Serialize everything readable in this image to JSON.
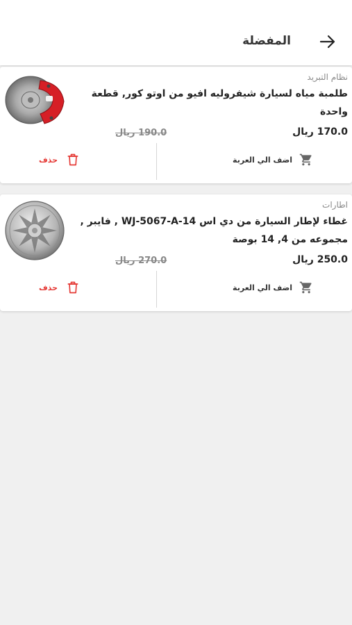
{
  "header": {
    "title": "المفضلة",
    "back_icon": "arrow-right-icon"
  },
  "colors": {
    "accent_red": "#e53935",
    "background": "#f0f0f0"
  },
  "favorites": [
    {
      "category": "نظام التبريد",
      "name": "طلمبة مياه لسيارة شيفروليه افيو من اوتو كور, قطعة واحدة",
      "price": "170.0 ريال",
      "old_price": "190.0 ريال",
      "add_to_cart_label": "اضف الي العربة",
      "delete_label": "حذف",
      "image": "brake-disc-caliper-image"
    },
    {
      "category": "اطارات",
      "name": "غطاء لإطار السيارة من دي اس WJ-5067-A-14 , فايبر , مجموعه من 4, 14 بوصة",
      "price": "250.0 ريال",
      "old_price": "270.0 ريال",
      "add_to_cart_label": "اضف الي العربة",
      "delete_label": "حذف",
      "image": "wheel-cover-image"
    }
  ]
}
